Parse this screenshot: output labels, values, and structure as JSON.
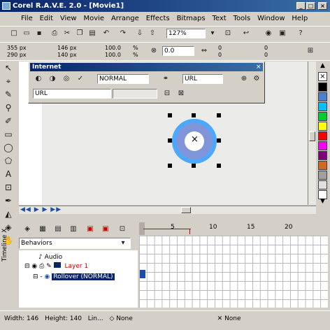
{
  "window": {
    "title": "Corel R.A.V.E. 2.0 - [Movie1]"
  },
  "menu": [
    "File",
    "Edit",
    "View",
    "Movie",
    "Arrange",
    "Effects",
    "Bitmaps",
    "Text",
    "Tools",
    "Window",
    "Help"
  ],
  "toolbar": {
    "zoom": "127%"
  },
  "propbar": {
    "x": "355 px",
    "y": "290 px",
    "w": "146 px",
    "h": "140 px",
    "sx": "100.0",
    "sy": "100.0",
    "angle": "0.0",
    "pct": "%",
    "n1": "0",
    "n2": "0",
    "n3": "0",
    "n4": "0"
  },
  "internet_bar": {
    "title": "Internet",
    "mode": "NORMAL",
    "url_label": "URL",
    "url_value": "URL"
  },
  "docker": {
    "label": "Timeline X"
  },
  "timeline": {
    "panel_title": "Behaviors",
    "items": [
      {
        "name": "Audio"
      },
      {
        "name": "Layer 1"
      },
      {
        "name": "Rollover (NORMAL)"
      }
    ],
    "ruler": [
      "5",
      "10",
      "15",
      "20"
    ]
  },
  "palette": {
    "colors": [
      "#000000",
      "#4a7fd4",
      "#00c0ff",
      "#00cc33",
      "#ffff00",
      "#ff0000",
      "#ff00ff",
      "#800080",
      "#d2691e",
      "#a0a0a0",
      "#e0e0e0",
      "#ffffff"
    ]
  },
  "status": {
    "width": "Width: 146",
    "height": "Height: 140",
    "line": "Lin...",
    "fill_none": "None",
    "outline_none": "None"
  }
}
